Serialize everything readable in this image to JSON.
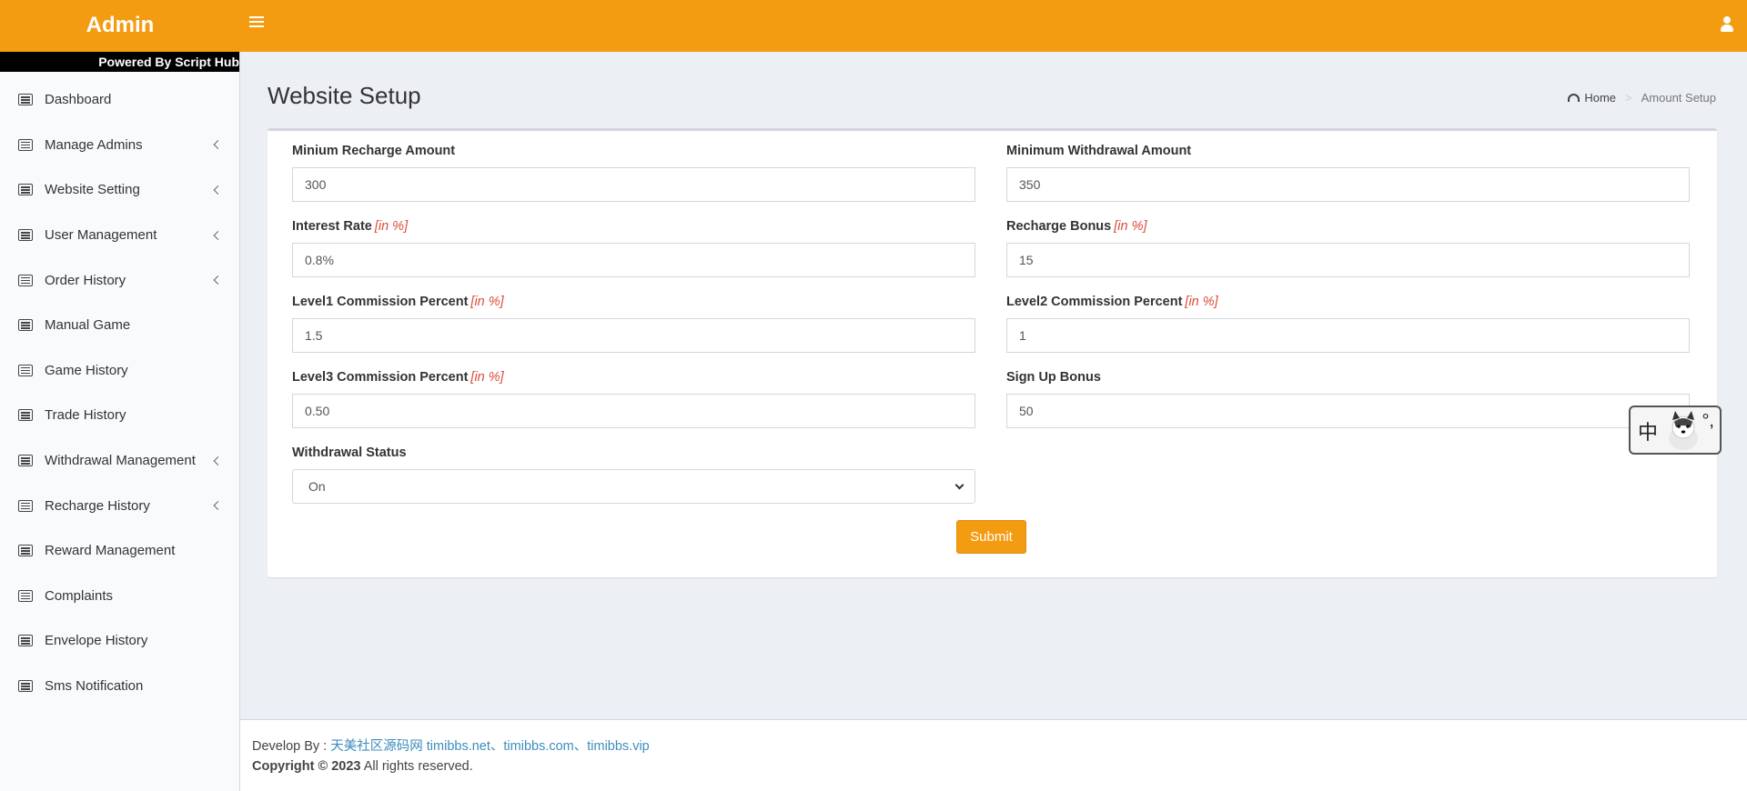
{
  "header": {
    "logo": "Admin",
    "toggle_icon": "bars-icon",
    "user_icon": "user-icon",
    "brand_color": "#f39c12"
  },
  "sidebar": {
    "powered_by": "Powered By Script Hub",
    "items": [
      {
        "label": "Dashboard",
        "has_submenu": false
      },
      {
        "label": "Manage Admins",
        "has_submenu": true
      },
      {
        "label": "Website Setting",
        "has_submenu": true
      },
      {
        "label": "User Management",
        "has_submenu": true
      },
      {
        "label": "Order History",
        "has_submenu": true
      },
      {
        "label": "Manual Game",
        "has_submenu": false
      },
      {
        "label": "Game History",
        "has_submenu": false
      },
      {
        "label": "Trade History",
        "has_submenu": false
      },
      {
        "label": "Withdrawal Management",
        "has_submenu": true
      },
      {
        "label": "Recharge History",
        "has_submenu": true
      },
      {
        "label": "Reward Management",
        "has_submenu": false
      },
      {
        "label": "Complaints",
        "has_submenu": false
      },
      {
        "label": "Envelope History",
        "has_submenu": false
      },
      {
        "label": "Sms Notification",
        "has_submenu": false
      }
    ]
  },
  "content": {
    "title": "Website Setup",
    "breadcrumb": {
      "home": "Home",
      "separator": ">",
      "current": "Amount Setup"
    }
  },
  "form": {
    "unit": "[in %]",
    "fields": {
      "min_recharge": {
        "label": "Minium Recharge Amount",
        "value": "300"
      },
      "min_withdrawal": {
        "label": "Minimum Withdrawal Amount",
        "value": "350"
      },
      "interest_rate": {
        "label": "Interest Rate",
        "value": "0.8%"
      },
      "recharge_bonus": {
        "label": "Recharge Bonus",
        "value": "15"
      },
      "level1": {
        "label": "Level1 Commission Percent",
        "value": "1.5"
      },
      "level2": {
        "label": "Level2 Commission Percent",
        "value": "1"
      },
      "level3": {
        "label": "Level3 Commission Percent",
        "value": "0.50"
      },
      "signup_bonus": {
        "label": "Sign Up Bonus",
        "value": "50"
      },
      "withdrawal_status": {
        "label": "Withdrawal Status",
        "value": "On"
      }
    },
    "submit_label": "Submit"
  },
  "ime": {
    "char": "中",
    "punct": "°,"
  },
  "footer": {
    "develop_prefix": "Develop By :",
    "develop_links": "天美社区源码网 timibbs.net、timibbs.com、timibbs.vip",
    "copyright": "Copyright © 2023",
    "rights": "All rights reserved."
  }
}
